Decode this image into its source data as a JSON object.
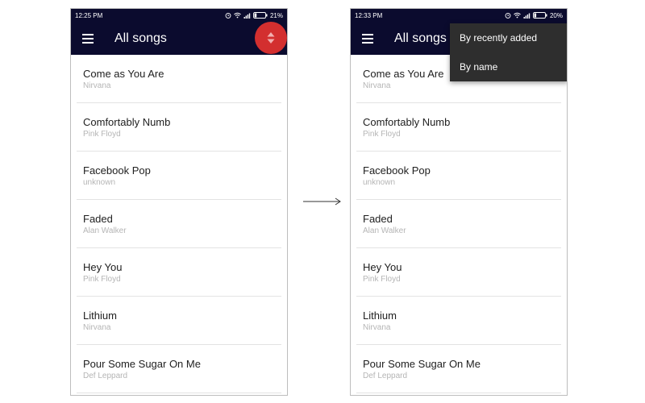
{
  "colors": {
    "appbar": "#0b0b2e",
    "fab": "#d32f2f",
    "menu_bg": "#2e2e2e",
    "artist_text": "#b5b5b5"
  },
  "left": {
    "status": {
      "time": "12:25 PM",
      "battery": "21%",
      "battery_level": 0.21
    },
    "header": {
      "title": "All songs",
      "menu_icon": "hamburger-icon",
      "sort_icon": "sort-icon"
    },
    "songs": [
      {
        "title": "Come as You Are",
        "artist": "Nirvana"
      },
      {
        "title": "Comfortably Numb",
        "artist": "Pink Floyd"
      },
      {
        "title": "Facebook Pop",
        "artist": "unknown"
      },
      {
        "title": "Faded",
        "artist": "Alan Walker"
      },
      {
        "title": "Hey You",
        "artist": "Pink Floyd"
      },
      {
        "title": "Lithium",
        "artist": "Nirvana"
      },
      {
        "title": "Pour Some Sugar On Me",
        "artist": "Def Leppard"
      }
    ]
  },
  "right": {
    "status": {
      "time": "12:33 PM",
      "battery": "20%",
      "battery_level": 0.2
    },
    "header": {
      "title": "All songs",
      "menu_icon": "hamburger-icon"
    },
    "sort_menu": {
      "options": [
        "By recently added",
        "By name"
      ]
    },
    "songs": [
      {
        "title": "Come as You Are",
        "artist": "Nirvana"
      },
      {
        "title": "Comfortably Numb",
        "artist": "Pink Floyd"
      },
      {
        "title": "Facebook Pop",
        "artist": "unknown"
      },
      {
        "title": "Faded",
        "artist": "Alan Walker"
      },
      {
        "title": "Hey You",
        "artist": "Pink Floyd"
      },
      {
        "title": "Lithium",
        "artist": "Nirvana"
      },
      {
        "title": "Pour Some Sugar On Me",
        "artist": "Def Leppard"
      }
    ]
  },
  "transition_icon": "arrow-right-icon"
}
